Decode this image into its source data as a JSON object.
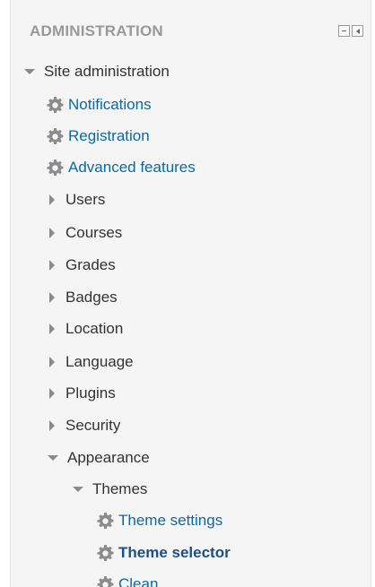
{
  "block": {
    "title": "ADMINISTRATION",
    "controls": [
      "minus-icon",
      "dock-icon"
    ]
  },
  "tree": {
    "root": "Site administration",
    "settings": [
      "Notifications",
      "Registration",
      "Advanced features"
    ],
    "categories": [
      "Users",
      "Courses",
      "Grades",
      "Badges",
      "Location",
      "Language",
      "Plugins",
      "Security"
    ],
    "appearance": "Appearance",
    "themes": "Themes",
    "theme_items": [
      "Theme settings",
      "Theme selector",
      "Clean"
    ]
  },
  "colors": {
    "link": "#0a6aa1",
    "active_link": "#1a4f8b",
    "text": "#333333",
    "title": "#999999",
    "background": "#f5f5f5"
  }
}
